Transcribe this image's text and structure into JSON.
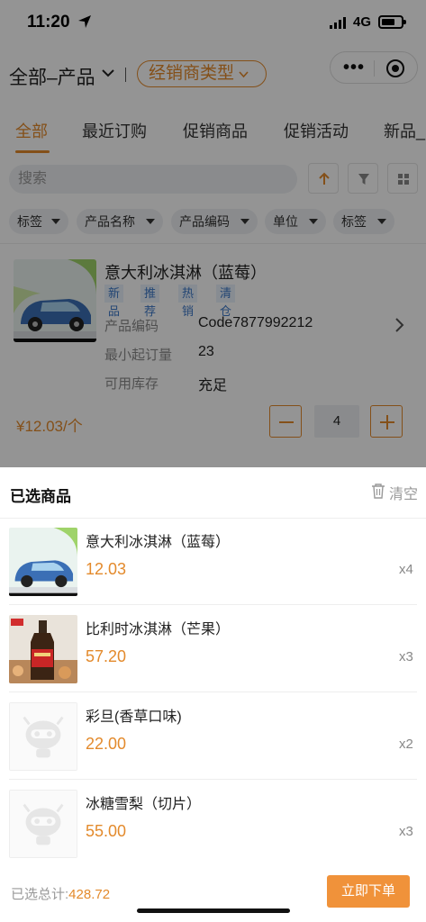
{
  "status": {
    "time": "11:20",
    "network": "4G"
  },
  "header": {
    "scope": "全部–产品",
    "dealer_type": "经销商类型"
  },
  "tabs": [
    "全部",
    "最近订购",
    "促销商品",
    "促销活动",
    "新品_"
  ],
  "search": {
    "placeholder": "搜索"
  },
  "filters": [
    "标签",
    "产品名称",
    "产品编码",
    "单位",
    "标签"
  ],
  "product": {
    "name": "意大利冰淇淋（蓝莓）",
    "tags": [
      "新品",
      "推荐",
      "热销",
      "清仓"
    ],
    "code_label": "产品编码",
    "code": "Code7877992212",
    "moq_label": "最小起订量",
    "moq": "23",
    "stock_label": "可用库存",
    "stock": "充足",
    "price": "¥12.03/个",
    "quantity": "4"
  },
  "selected_sheet": {
    "title": "已选商品",
    "clear_label": "清空",
    "items": [
      {
        "name": "意大利冰淇淋（蓝莓）",
        "price": "12.03",
        "count": "x4",
        "image": "car-image"
      },
      {
        "name": "比利时冰淇淋（芒果）",
        "price": "57.20",
        "count": "x3",
        "image": "bottle-image"
      },
      {
        "name": "彩旦(香草口味)",
        "price": "22.00",
        "count": "x2",
        "image": "placeholder-image"
      },
      {
        "name": "冰糖雪梨（切片）",
        "price": "55.00",
        "count": "x3",
        "image": "placeholder-image"
      }
    ],
    "total_label": "已选总计:",
    "total": "428.72",
    "order_button": "立即下单"
  },
  "colors": {
    "accent": "#e38a2c",
    "tag_text": "#3c78c8",
    "order_button": "#f0923a"
  }
}
